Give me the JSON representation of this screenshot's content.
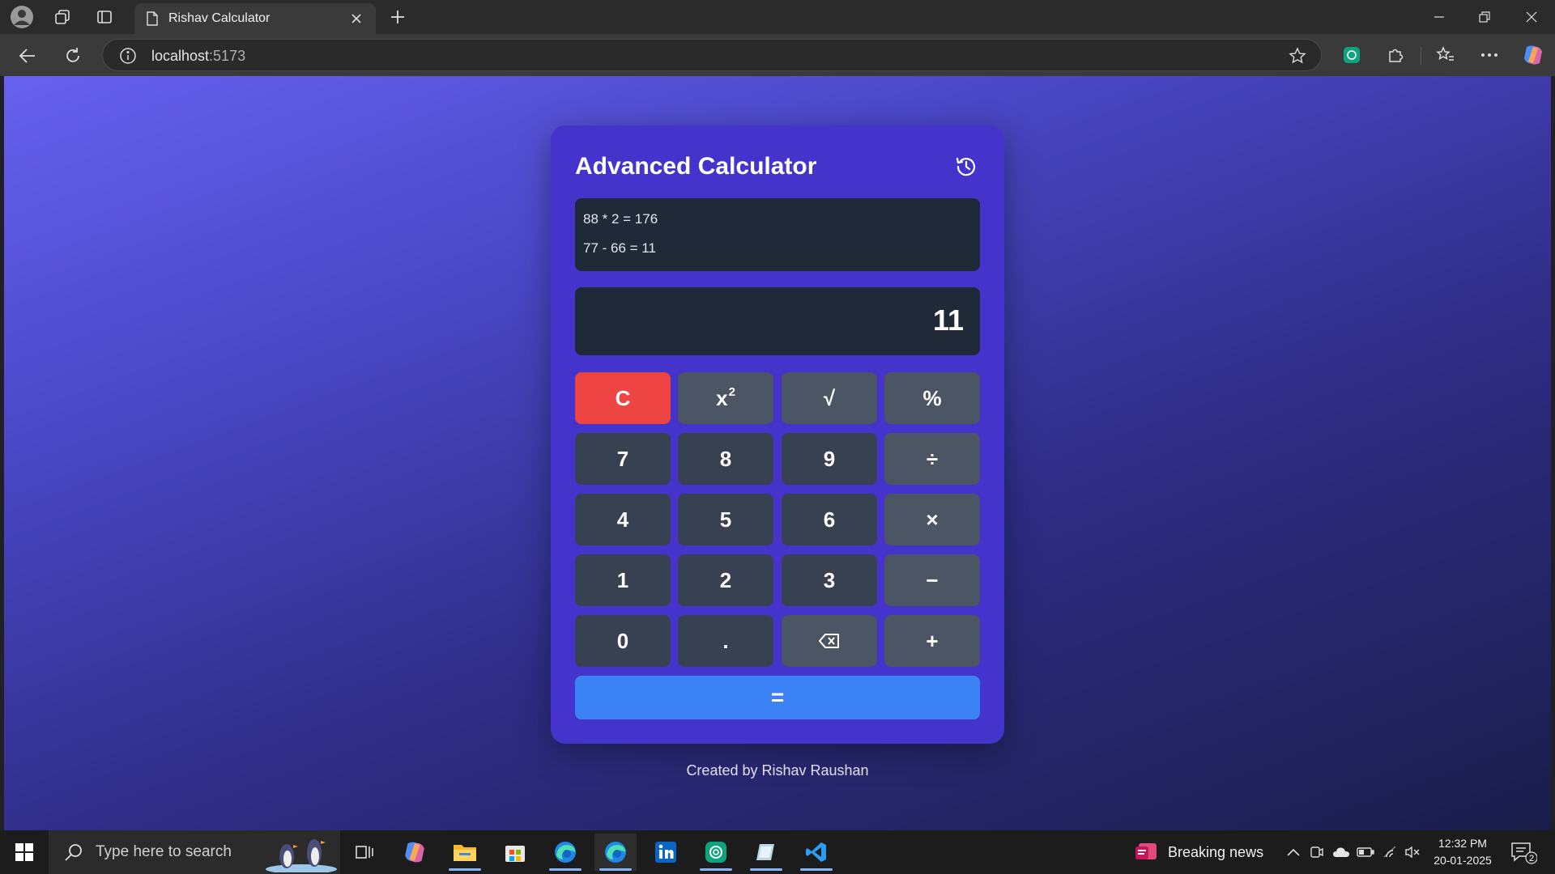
{
  "browser": {
    "tab_title": "Rishav Calculator",
    "url_host": "localhost",
    "url_port": ":5173"
  },
  "calculator": {
    "title": "Advanced Calculator",
    "history": [
      "88 * 2 = 176",
      "77 - 66 = 11"
    ],
    "display": "11",
    "keys": {
      "clear": "C",
      "square_base": "x",
      "square_exp": "2",
      "sqrt": "√",
      "percent": "%",
      "seven": "7",
      "eight": "8",
      "nine": "9",
      "divide": "÷",
      "four": "4",
      "five": "5",
      "six": "6",
      "multiply": "×",
      "one": "1",
      "two": "2",
      "three": "3",
      "minus": "−",
      "zero": "0",
      "dot": ".",
      "plus": "+",
      "equals": "="
    },
    "footer": "Created by Rishav Raushan"
  },
  "taskbar": {
    "search_placeholder": "Type here to search",
    "news": "Breaking news",
    "time": "12:32 PM",
    "date": "20-01-2025",
    "notification_count": "2"
  },
  "colors": {
    "card": "#4434cc",
    "panel": "#1f2937",
    "key": "#374151",
    "key_operator": "#4b5563",
    "clear": "#ef4444",
    "equals": "#3b82f6"
  }
}
